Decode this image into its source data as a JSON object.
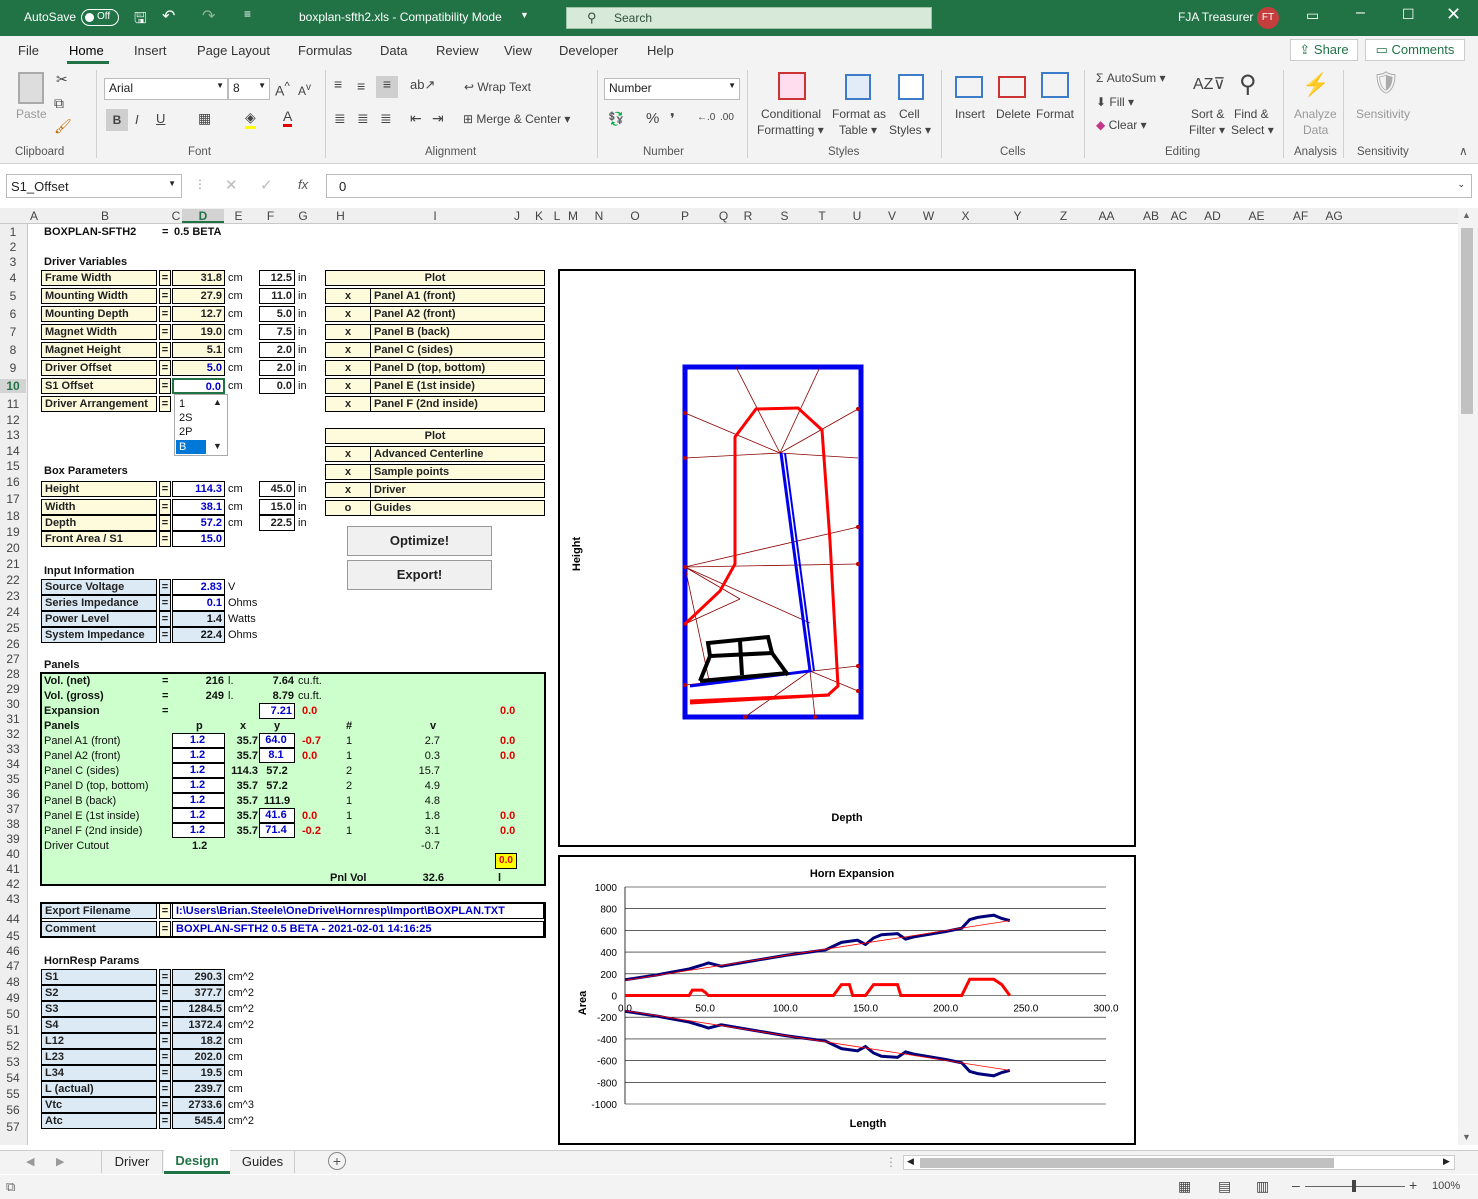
{
  "titlebar": {
    "autosave": "AutoSave",
    "toggle": "Off",
    "filename": "boxplan-sfth2.xls - Compatibility Mode",
    "search": "Search",
    "user": "FJA Treasurer",
    "initials": "FT"
  },
  "menu": [
    "File",
    "Home",
    "Insert",
    "Page Layout",
    "Formulas",
    "Data",
    "Review",
    "View",
    "Developer",
    "Help"
  ],
  "share": "Share",
  "comments": "Comments",
  "ribbon": {
    "paste": "Paste",
    "font_name": "Arial",
    "font_size": "8",
    "wrap": "Wrap Text",
    "merge": "Merge & Center",
    "number_format": "Number",
    "cond1": "Conditional",
    "cond2": "Formatting",
    "fmt1": "Format as",
    "fmt2": "Table",
    "cell1": "Cell",
    "cell2": "Styles",
    "insert": "Insert",
    "delete": "Delete",
    "format": "Format",
    "autosum": "AutoSum",
    "fill": "Fill",
    "clear": "Clear",
    "sort1": "Sort &",
    "sort2": "Filter",
    "find1": "Find &",
    "find2": "Select",
    "analyze1": "Analyze",
    "analyze2": "Data",
    "sens": "Sensitivity",
    "groups": [
      "Clipboard",
      "Font",
      "Alignment",
      "Number",
      "Styles",
      "Cells",
      "Editing",
      "Analysis",
      "Sensitivity"
    ]
  },
  "formula": {
    "namebox": "S1_Offset",
    "value": "0",
    "fx": "fx"
  },
  "columns": [
    "A",
    "B",
    "C",
    "D",
    "E",
    "F",
    "G",
    "H",
    "I",
    "J",
    "K",
    "L",
    "M",
    "N",
    "O",
    "P",
    "Q",
    "R",
    "S",
    "T",
    "U",
    "V",
    "W",
    "X",
    "Y",
    "Z",
    "AA",
    "AB",
    "AC",
    "AD",
    "AE",
    "AF",
    "AG"
  ],
  "title": "BOXPLAN-SFTH2",
  "version": "0.5 BETA",
  "driver_vars": {
    "header": "Driver Variables",
    "rows": [
      {
        "label": "Frame Width",
        "cm": "31.8",
        "in": "12.5"
      },
      {
        "label": "Mounting Width",
        "cm": "27.9",
        "in": "11.0"
      },
      {
        "label": "Mounting Depth",
        "cm": "12.7",
        "in": "5.0"
      },
      {
        "label": "Magnet Width",
        "cm": "19.0",
        "in": "7.5"
      },
      {
        "label": "Magnet Height",
        "cm": "5.1",
        "in": "2.0"
      },
      {
        "label": "Driver Offset",
        "cm": "5.0",
        "in": "2.0"
      },
      {
        "label": "S1 Offset",
        "cm": "0.0",
        "in": "0.0"
      },
      {
        "label": "Driver Arrangement",
        "cm": "",
        "in": ""
      }
    ]
  },
  "units": {
    "cm": "cm",
    "in": "in",
    "eq": "="
  },
  "dropdown": [
    "1",
    "2S",
    "2P",
    "B"
  ],
  "plot1": {
    "header": "Plot",
    "rows": [
      {
        "m": "x",
        "t": "Panel A1 (front)"
      },
      {
        "m": "x",
        "t": "Panel A2 (front)"
      },
      {
        "m": "x",
        "t": "Panel B (back)"
      },
      {
        "m": "x",
        "t": "Panel C (sides)"
      },
      {
        "m": "x",
        "t": "Panel D (top, bottom)"
      },
      {
        "m": "x",
        "t": "Panel E (1st inside)"
      },
      {
        "m": "x",
        "t": "Panel F (2nd inside)"
      }
    ]
  },
  "plot2": {
    "header": "Plot",
    "rows": [
      {
        "m": "x",
        "t": "Advanced Centerline"
      },
      {
        "m": "x",
        "t": "Sample points"
      },
      {
        "m": "x",
        "t": "Driver"
      },
      {
        "m": "o",
        "t": "Guides"
      }
    ]
  },
  "box_params": {
    "header": "Box Parameters",
    "rows": [
      {
        "label": "Height",
        "cm": "114.3",
        "in": "45.0"
      },
      {
        "label": "Width",
        "cm": "38.1",
        "in": "15.0"
      },
      {
        "label": "Depth",
        "cm": "57.2",
        "in": "22.5"
      },
      {
        "label": "Front Area / S1",
        "cm": "15.0",
        "in": ""
      }
    ]
  },
  "buttons": {
    "optimize": "Optimize!",
    "export": "Export!"
  },
  "input_info": {
    "header": "Input Information",
    "rows": [
      {
        "label": "Source Voltage",
        "v": "2.83",
        "u": "V"
      },
      {
        "label": "Series Impedance",
        "v": "0.1",
        "u": "Ohms"
      },
      {
        "label": "Power Level",
        "v": "1.4",
        "u": "Watts"
      },
      {
        "label": "System Impedance",
        "v": "22.4",
        "u": "Ohms"
      }
    ]
  },
  "panels": {
    "header": "Panels",
    "vol_net": {
      "l": "Vol. (net)",
      "a": "216",
      "u1": "l.",
      "b": "7.64",
      "u2": "cu.ft."
    },
    "vol_gross": {
      "l": "Vol. (gross)",
      "a": "249",
      "u1": "l.",
      "b": "8.79",
      "u2": "cu.ft."
    },
    "expansion": {
      "l": "Expansion",
      "y": "7.21",
      "r": "0.0",
      "r2": "0.0"
    },
    "cols": {
      "label": "Panels",
      "p": "p",
      "x": "x",
      "y": "y",
      "n": "#",
      "v": "v"
    },
    "rows": [
      {
        "l": "Panel A1 (front)",
        "p": "1.2",
        "x": "35.7",
        "y": "64.0",
        "d": "-0.7",
        "n": "1",
        "v": "2.7",
        "r": "0.0"
      },
      {
        "l": "Panel A2 (front)",
        "p": "1.2",
        "x": "35.7",
        "y": "8.1",
        "d": "0.0",
        "n": "1",
        "v": "0.3",
        "r": "0.0"
      },
      {
        "l": "Panel C (sides)",
        "p": "1.2",
        "x": "114.3",
        "y": "57.2",
        "d": "",
        "n": "2",
        "v": "15.7",
        "r": ""
      },
      {
        "l": "Panel D (top, bottom)",
        "p": "1.2",
        "x": "35.7",
        "y": "57.2",
        "d": "",
        "n": "2",
        "v": "4.9",
        "r": ""
      },
      {
        "l": "Panel B (back)",
        "p": "1.2",
        "x": "35.7",
        "y": "111.9",
        "d": "",
        "n": "1",
        "v": "4.8",
        "r": ""
      },
      {
        "l": "Panel E (1st inside)",
        "p": "1.2",
        "x": "35.7",
        "y": "41.6",
        "d": "0.0",
        "n": "1",
        "v": "1.8",
        "r": "0.0"
      },
      {
        "l": "Panel F (2nd inside)",
        "p": "1.2",
        "x": "35.7",
        "y": "71.4",
        "d": "-0.2",
        "n": "1",
        "v": "3.1",
        "r": "0.0"
      }
    ],
    "cutout": {
      "l": "Driver Cutout",
      "p": "1.2",
      "v": "-0.7"
    },
    "total_box": "0.0",
    "pnl_vol_label": "Pnl Vol",
    "pnl_vol": "32.6",
    "pnl_unit": "l"
  },
  "export": {
    "filename_label": "Export Filename",
    "filename": "I:\\Users\\Brian.Steele\\OneDrive\\Hornresp\\Import\\BOXPLAN.TXT",
    "comment_label": "Comment",
    "comment": "BOXPLAN-SFTH2 0.5 BETA - 2021-02-01 14:16:25"
  },
  "hornresp": {
    "header": "HornResp Params",
    "rows": [
      {
        "l": "S1",
        "v": "290.3",
        "u": "cm^2"
      },
      {
        "l": "S2",
        "v": "377.7",
        "u": "cm^2"
      },
      {
        "l": "S3",
        "v": "1284.5",
        "u": "cm^2"
      },
      {
        "l": "S4",
        "v": "1372.4",
        "u": "cm^2"
      },
      {
        "l": "L12",
        "v": "18.2",
        "u": "cm"
      },
      {
        "l": "L23",
        "v": "202.0",
        "u": "cm"
      },
      {
        "l": "L34",
        "v": "19.5",
        "u": "cm"
      },
      {
        "l": "L (actual)",
        "v": "239.7",
        "u": "cm"
      },
      {
        "l": "Vtc",
        "v": "2733.6",
        "u": "cm^3"
      },
      {
        "l": "Atc",
        "v": "545.4",
        "u": "cm^2"
      }
    ]
  },
  "chart_top": {
    "xlabel": "Depth",
    "ylabel": "Height"
  },
  "chart_data": {
    "type": "line",
    "title": "Horn Expansion",
    "xlabel": "Length",
    "ylabel": "Area",
    "xlim": [
      0,
      300
    ],
    "ylim": [
      -1000,
      1000
    ],
    "xticks": [
      "0.0",
      "50.0",
      "100.0",
      "150.0",
      "200.0",
      "250.0",
      "300.0"
    ],
    "yticks": [
      "1000",
      "800",
      "600",
      "400",
      "200",
      "0",
      "-200",
      "-400",
      "-600",
      "-800",
      "-1000"
    ],
    "series": [
      {
        "color": "#00007a",
        "x": [
          0,
          20,
          40,
          48,
          52,
          60,
          80,
          100,
          125,
          135,
          145,
          150,
          155,
          160,
          170,
          175,
          180,
          200,
          210,
          215,
          220,
          225,
          230,
          235,
          240
        ],
        "y": [
          145,
          190,
          245,
          280,
          300,
          270,
          320,
          370,
          420,
          490,
          510,
          470,
          530,
          560,
          570,
          520,
          540,
          590,
          620,
          700,
          720,
          730,
          740,
          710,
          690
        ]
      },
      {
        "color": "#00007a",
        "x": [
          0,
          20,
          40,
          48,
          52,
          60,
          80,
          100,
          125,
          135,
          145,
          150,
          155,
          160,
          170,
          175,
          180,
          200,
          210,
          215,
          220,
          225,
          230,
          235,
          240
        ],
        "y": [
          -145,
          -190,
          -245,
          -280,
          -300,
          -270,
          -320,
          -370,
          -420,
          -490,
          -510,
          -470,
          -530,
          -560,
          -570,
          -520,
          -540,
          -590,
          -620,
          -700,
          -720,
          -730,
          -740,
          -710,
          -690
        ]
      },
      {
        "color": "#ff0000",
        "x": [
          0,
          40,
          42,
          45,
          48,
          50,
          52,
          125,
          130,
          135,
          140,
          142,
          150,
          155,
          160,
          170,
          172,
          200,
          210,
          215,
          220,
          225,
          230,
          235,
          240
        ],
        "y": [
          0,
          0,
          50,
          50,
          50,
          30,
          0,
          0,
          0,
          100,
          100,
          0,
          0,
          100,
          100,
          100,
          0,
          0,
          0,
          150,
          150,
          150,
          150,
          100,
          0
        ]
      },
      {
        "color": "#ff0000",
        "x": [
          0,
          240
        ],
        "y": [
          140,
          690
        ]
      },
      {
        "color": "#ff0000",
        "x": [
          0,
          240
        ],
        "y": [
          -140,
          -690
        ]
      }
    ]
  },
  "sheets": [
    "Driver",
    "Design",
    "Guides"
  ],
  "zoom": "100%"
}
